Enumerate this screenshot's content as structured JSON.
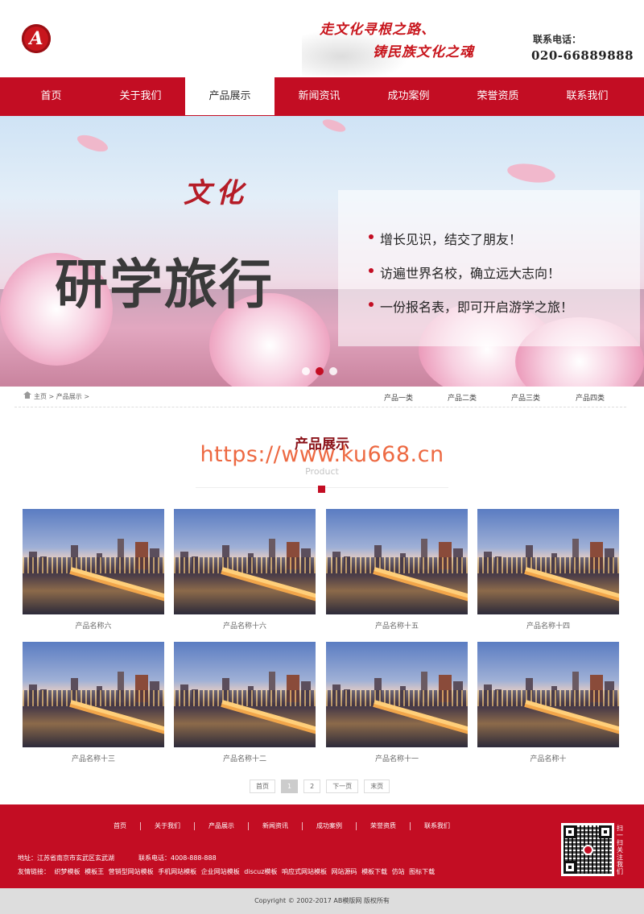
{
  "header": {
    "logo_letter": "A",
    "slogan_line1": "走文化寻根之路、",
    "slogan_line2": "铸民族文化之魂",
    "phone_label": "联系电话：",
    "phone_number": "020-66889888"
  },
  "nav": {
    "items": [
      "首页",
      "关于我们",
      "产品展示",
      "新闻资讯",
      "成功案例",
      "荣誉资质",
      "联系我们"
    ],
    "active": "产品展示"
  },
  "banner": {
    "culture_text": "文化",
    "title": "研学旅行",
    "bullets": [
      "增长见识，结交了朋友！",
      "访遍世界名校，确立远大志向！",
      "一份报名表，即可开启游学之旅！"
    ],
    "slide_count": 3,
    "active_slide": 2
  },
  "breadcrumb": {
    "text": "主页 > 产品展示 >",
    "categories": [
      "产品一类",
      "产品二类",
      "产品三类",
      "产品四类"
    ]
  },
  "section": {
    "title": "产品展示",
    "subtitle": "Product",
    "watermark": "https://www.ku668.cn"
  },
  "products": [
    "产品名称六",
    "产品名称十六",
    "产品名称十五",
    "产品名称十四",
    "产品名称十三",
    "产品名称十二",
    "产品名称十一",
    "产品名称十"
  ],
  "pagination": [
    "首页",
    "1",
    "2",
    "下一页",
    "末页"
  ],
  "footer": {
    "nav": [
      "首页",
      "关于我们",
      "产品展示",
      "新闻资讯",
      "成功案例",
      "荣誉资质",
      "联系我们"
    ],
    "address": "地址：江苏省南京市玄武区玄武湖",
    "tel": "联系电话：4008-888-888",
    "links_label": "友情链接：",
    "links": [
      "织梦模板",
      "模板王",
      "营销型网站模板",
      "手机网站模板",
      "企业网站模板",
      "discuz模板",
      "响应式网站模板",
      "网站源码",
      "模板下载",
      "仿站",
      "图标下载"
    ],
    "qr_text": "扫一扫关注我们",
    "copyright": "Copyright © 2002-2017 AB模版网 版权所有"
  },
  "colors": {
    "brand_red": "#c30d23",
    "title_red": "#8a1118",
    "watermark": "#eb5c32"
  }
}
